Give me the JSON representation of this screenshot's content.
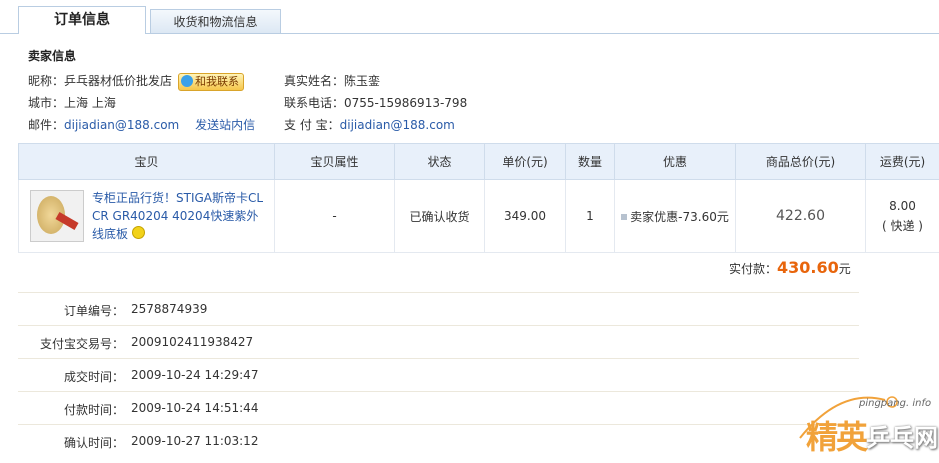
{
  "tabs": [
    {
      "label": "订单信息",
      "active": true
    },
    {
      "label": "收货和物流信息",
      "active": false
    }
  ],
  "seller": {
    "section_title": "卖家信息",
    "nickname_label": "昵称：",
    "nickname": "乒乓器材低价批发店",
    "contact_button": "和我联系",
    "city_label": "城市：",
    "city": "上海 上海",
    "email_label": "邮件：",
    "email": "dijiadian@188.com",
    "send_message": "发送站内信",
    "realname_label": "真实姓名：",
    "realname": "陈玉銮",
    "phone_label": "联系电话：",
    "phone": "0755-15986913-798",
    "alipay_label": "支 付 宝：",
    "alipay": "dijiadian@188.com"
  },
  "table": {
    "headers": [
      "宝贝",
      "宝贝属性",
      "状态",
      "单价(元)",
      "数量",
      "优惠",
      "商品总价(元)",
      "运费(元)"
    ],
    "row": {
      "title": "专柜正品行货！STIGA斯帝卡CL CR GR40204 40204快速紫外线底板",
      "attr": "-",
      "status": "已确认收货",
      "price": "349.00",
      "qty": "1",
      "discount": "卖家优惠-73.60元",
      "total": "422.60",
      "shipping": "8.00",
      "shipping_type": "( 快递 )"
    }
  },
  "paid": {
    "label": "实付款：",
    "amount": "430.60",
    "unit": "元"
  },
  "details": [
    {
      "label": "订单编号：",
      "value": "2578874939"
    },
    {
      "label": "支付宝交易号：",
      "value": "2009102411938427"
    },
    {
      "label": "成交时间：",
      "value": "2009-10-24 14:29:47"
    },
    {
      "label": "付款时间：",
      "value": "2009-10-24 14:51:44"
    },
    {
      "label": "确认时间：",
      "value": "2009-10-27 11:03:12"
    }
  ],
  "watermark": {
    "url": "pingpang. info",
    "logo_a": "精英",
    "logo_b": "乒乓网"
  },
  "colors": {
    "link": "#2a5ba8",
    "paid": "#e8650c",
    "header_bg": "#e8f0fa"
  }
}
